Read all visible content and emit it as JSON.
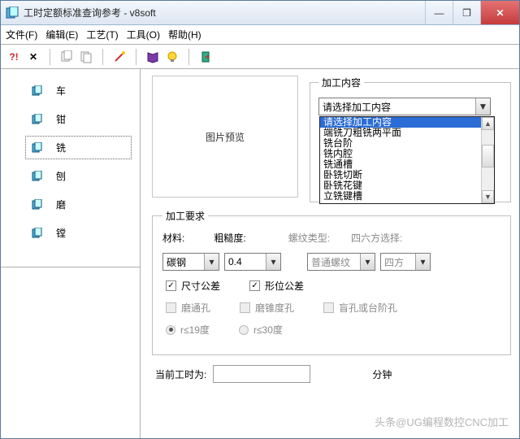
{
  "title": "工时定额标准查询参考 - v8soft",
  "menus": [
    "文件(F)",
    "编辑(E)",
    "工艺(T)",
    "工具(O)",
    "帮助(H)"
  ],
  "sidebar": {
    "items": [
      {
        "label": "车"
      },
      {
        "label": "钳"
      },
      {
        "label": "铣"
      },
      {
        "label": "刨"
      },
      {
        "label": "磨"
      },
      {
        "label": "镗"
      }
    ]
  },
  "preview_label": "图片预览",
  "process": {
    "legend": "加工内容",
    "selected": "请选择加工内容",
    "options": [
      "请选择加工内容",
      "端铣刀粗铣两平面",
      "铣台阶",
      "铣内腔",
      "铣通槽",
      "卧铣切断",
      "卧铣花键",
      "立铣键槽"
    ]
  },
  "req": {
    "legend": "加工要求",
    "material_label": "材料:",
    "material_value": "碳钢",
    "rough_label": "粗糙度:",
    "rough_value": "0.4",
    "thread_label": "螺纹类型:",
    "thread_value": "普通螺纹",
    "square_label": "四六方选择:",
    "square_value": "四方",
    "chk_size": "尺寸公差",
    "chk_geo": "形位公差",
    "chk_a": "磨通孔",
    "chk_b": "磨锥度孔",
    "chk_c": "盲孔或台阶孔",
    "rad_a": "r≤19度",
    "rad_b": "r≤30度"
  },
  "bottom": {
    "label": "当前工时为:",
    "minutes": "分钟"
  },
  "watermark": "头条@UG编程数控CNC加工"
}
